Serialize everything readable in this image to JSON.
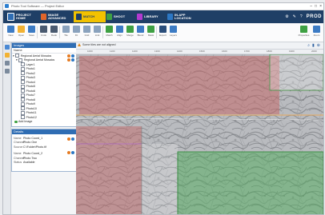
{
  "window": {
    "title": "Photo Tool Software — Project Editor"
  },
  "ribbon": {
    "tabs": [
      {
        "label": "PROJECT\nHOME",
        "color": "#2f6db3"
      },
      {
        "label": "IMAGE\nADVANCED",
        "color": "#e0652a"
      },
      {
        "label": "MATCH",
        "color": "#2f6db3",
        "active": true
      },
      {
        "label": "SHOOT",
        "color": "#3ea043"
      },
      {
        "label": "LIBRARY",
        "color": "#b23ad0"
      },
      {
        "label": "IN-APP\nLOCATION",
        "color": "#2c77c4"
      }
    ],
    "brand": "PROD",
    "right_icons": [
      "gear-icon",
      "wrench-icon",
      "help-icon"
    ]
  },
  "toolbar": {
    "buttons": [
      {
        "icon": "new-icon",
        "label": "New",
        "color": "#3c7bc4"
      },
      {
        "icon": "open-icon",
        "label": "Open",
        "color": "#f2b233"
      },
      {
        "icon": "save-icon",
        "label": "Save",
        "color": "#3c7bc4"
      },
      {
        "icon": "undo-icon",
        "label": "Undo",
        "color": "#4a5a70"
      },
      {
        "icon": "redo-icon",
        "label": "Redo",
        "color": "#4a5a70"
      },
      {
        "icon": "tile-icon",
        "label": "Tile",
        "color": "#8aa2bd"
      },
      {
        "icon": "fit-icon",
        "label": "Fit",
        "color": "#8aa2bd"
      },
      {
        "icon": "grid-icon",
        "label": "Grid",
        "color": "#8aa2bd"
      },
      {
        "icon": "link-icon",
        "label": "Link",
        "color": "#8aa2bd"
      },
      {
        "icon": "match-icon",
        "label": "Match",
        "color": "#3ea043"
      },
      {
        "icon": "align-icon",
        "label": "Align",
        "color": "#3c7bc4"
      },
      {
        "icon": "merge-icon",
        "label": "Merge",
        "color": "#3ea043"
      },
      {
        "icon": "blend-icon",
        "label": "Blend",
        "color": "#3c7bc4"
      },
      {
        "icon": "mask-icon",
        "label": "Mask",
        "color": "#3ea043"
      },
      {
        "icon": "export-icon",
        "label": "Export",
        "color": "#2a4d7a"
      },
      {
        "icon": "layers-icon",
        "label": "Layers",
        "color": "#3c7bc4"
      }
    ],
    "right_buttons": [
      {
        "icon": "properties-icon",
        "label": "Properties",
        "color": "#3ea043"
      },
      {
        "icon": "zoom-icon",
        "label": "Zoom",
        "color": "#3c7bc4"
      }
    ]
  },
  "left_rail": [
    "search-icon",
    "folder-icon",
    "layers-icon",
    "settings-icon"
  ],
  "images_panel": {
    "title": "Images",
    "tab": "Name",
    "group_label": "Regional Aerial Mosaics",
    "subgroup_label": "Regional Aerial Mosaics",
    "items": [
      "Layer1",
      "Photo1",
      "Photo2",
      "Photo3",
      "Photo4",
      "Photo5",
      "Photo6",
      "Photo7",
      "Photo8",
      "Photo9",
      "Photo10",
      "Photo11",
      "Photo12"
    ],
    "footer": "Add Image"
  },
  "details_panel": {
    "title": "Details",
    "rows": [
      {
        "k": "Name",
        "v": "Photo Coord_1"
      },
      {
        "k": "Channel",
        "v": "Photo One"
      },
      {
        "k": "Source",
        "v": "C:\\Folder\\Photo.tif"
      },
      {
        "k": "Name",
        "v": "Photo Coord_2"
      },
      {
        "k": "Channel",
        "v": "Photo Two"
      },
      {
        "k": "Status",
        "v": "Available"
      }
    ]
  },
  "main": {
    "tab_label": "Some tiles are not aligned",
    "ruler_ticks": [
      "1000",
      "1100",
      "1200",
      "1300",
      "1400",
      "1500",
      "1600",
      "1700",
      "1800",
      "1900",
      "2000"
    ],
    "tools": [
      "search-icon",
      "pin-icon",
      "zoom-in-icon"
    ],
    "tint_colors": {
      "red": "#c46a6a",
      "green": "#4fae5c",
      "gray": "#8d8f93"
    }
  }
}
